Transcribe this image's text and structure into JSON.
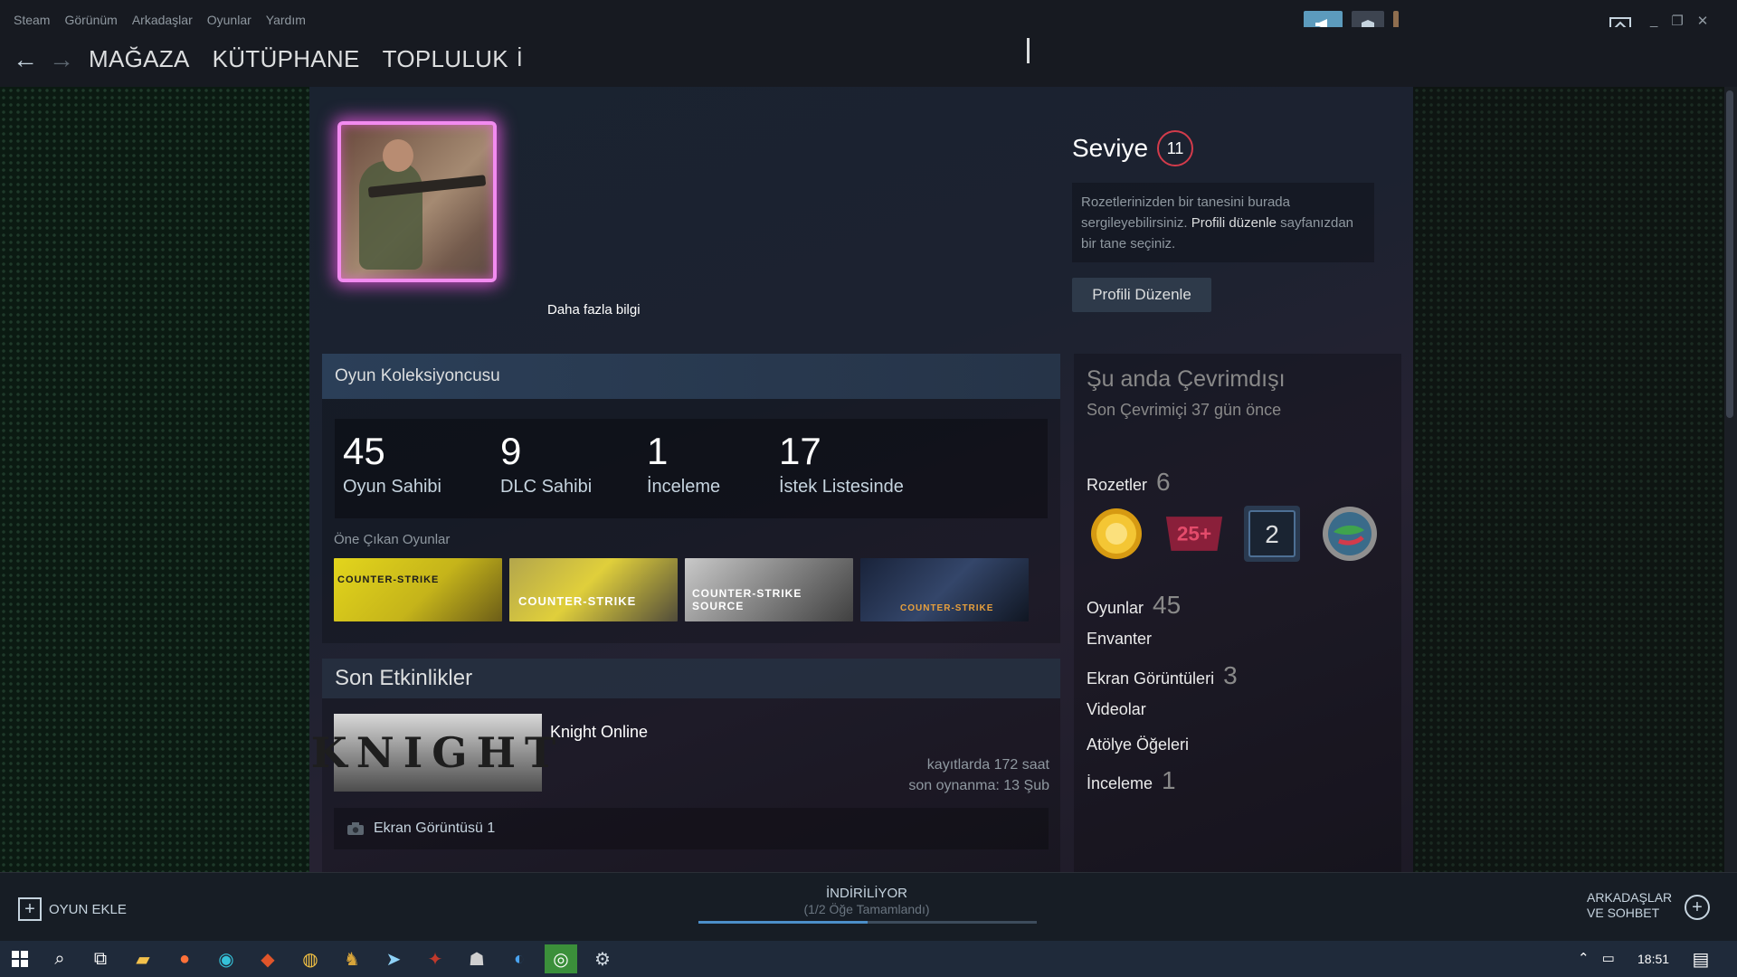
{
  "menubar": {
    "items": [
      "Steam",
      "Görünüm",
      "Arkadaşlar",
      "Oyunlar",
      "Yardım"
    ]
  },
  "nav": {
    "links": [
      "MAĞAZA",
      "KÜTÜPHANE",
      "TOPLULUK"
    ],
    "cut_text": "İ"
  },
  "profile": {
    "more_info": "Daha fazla bilgi",
    "level_label": "Seviye",
    "level_value": "11",
    "badge_hint_pre": "Rozetlerinizden bir tanesini burada sergileyebilirsiniz.",
    "badge_hint_link": "Profili düzenle",
    "badge_hint_post": "sayfanızdan bir tane seçiniz.",
    "edit_button": "Profili Düzenle"
  },
  "collector": {
    "title": "Oyun Koleksiyoncusu",
    "stats": [
      {
        "num": "45",
        "label": "Oyun Sahibi"
      },
      {
        "num": "9",
        "label": "DLC Sahibi"
      },
      {
        "num": "1",
        "label": "İnceleme"
      },
      {
        "num": "17",
        "label": "İstek Listesinde"
      }
    ],
    "featured_label": "Öne Çıkan Oyunlar",
    "featured": [
      {
        "caption": "COUNTER-STRIKE",
        "color": "#d6c51b"
      },
      {
        "caption": "COUNTER-STRIKE",
        "color": "#c9b33c"
      },
      {
        "caption": "COUNTER-STRIKE SOURCE",
        "color": "#8d8d8d"
      },
      {
        "caption": "COUNTER-STRIKE",
        "color": "#27344d"
      }
    ]
  },
  "recent": {
    "title": "Son Etkinlikler",
    "game_logo": "KNIGHT",
    "game_name": "Knight Online",
    "hours": "kayıtlarda 172 saat",
    "last_played": "son oynanma: 13 Şub",
    "screenshot": "Ekran Görüntüsü 1"
  },
  "rightcol": {
    "status": "Şu anda Çevrimdışı",
    "last_online": "Son Çevrimiçi 37 gün önce",
    "badges_label": "Rozetler",
    "badges_count": "6",
    "badge_two": "2",
    "badge_25": "25+",
    "games_label": "Oyunlar",
    "games_count": "45",
    "inventory": "Envanter",
    "screenshots_label": "Ekran Görüntüleri",
    "screenshots_count": "3",
    "videos": "Videolar",
    "workshop": "Atölye Öğeleri",
    "reviews_label": "İnceleme",
    "reviews_count": "1"
  },
  "bottombar": {
    "add_game": "OYUN EKLE",
    "downloading": "İNDİRİLİYOR",
    "downloading_sub": "(1/2 Öğe Tamamlandı)",
    "progress": 0.5,
    "friends_line1": "ARKADAŞLAR",
    "friends_line2": "VE SOHBET"
  },
  "taskbar": {
    "time": "18:51"
  }
}
